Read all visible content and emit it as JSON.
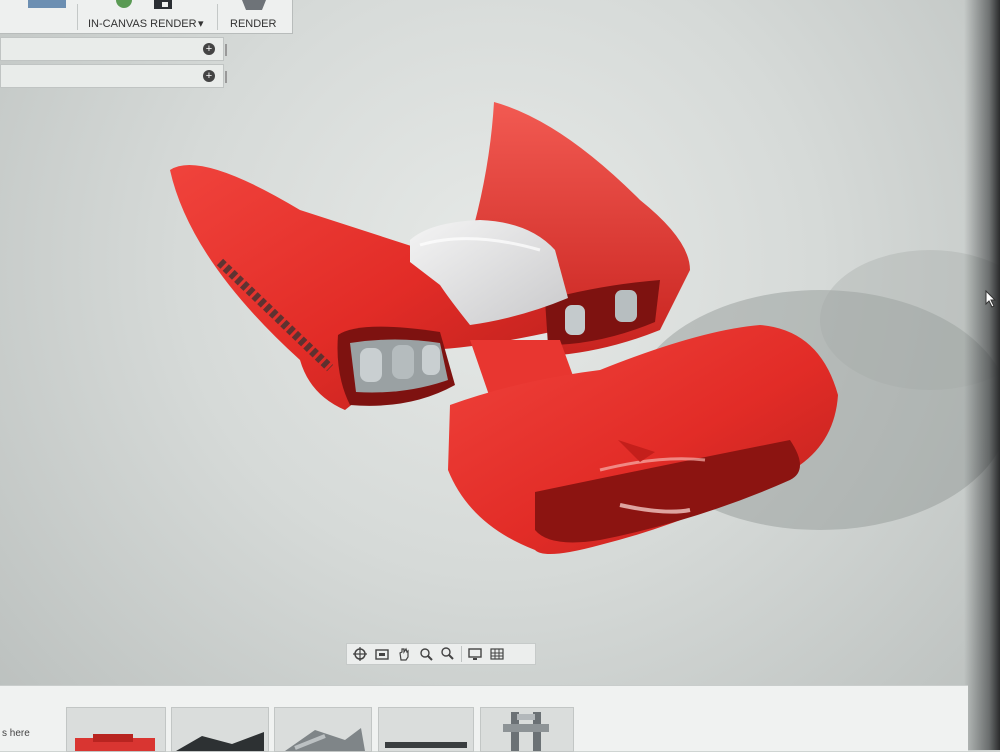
{
  "toolbar": {
    "in_canvas_render_label": "IN-CANVAS RENDER",
    "render_label": "RENDER",
    "dropdown_indicator": "▾"
  },
  "panels": [
    {
      "icon": "plus-circle-icon"
    },
    {
      "icon": "plus-circle-icon"
    }
  ],
  "navigation_bar": {
    "tools": [
      "orbit-icon",
      "look-at-icon",
      "pan-icon",
      "zoom-window-icon",
      "zoom-icon",
      "display-settings-icon",
      "grid-settings-icon"
    ]
  },
  "browser_strip": {
    "partial_text": "s here",
    "thumbnails": 5
  },
  "colors": {
    "model_red": "#e8302c",
    "model_dark": "#a91512",
    "canvas_bg": "#dfe2e0",
    "canopy": "#e9e9ea"
  }
}
